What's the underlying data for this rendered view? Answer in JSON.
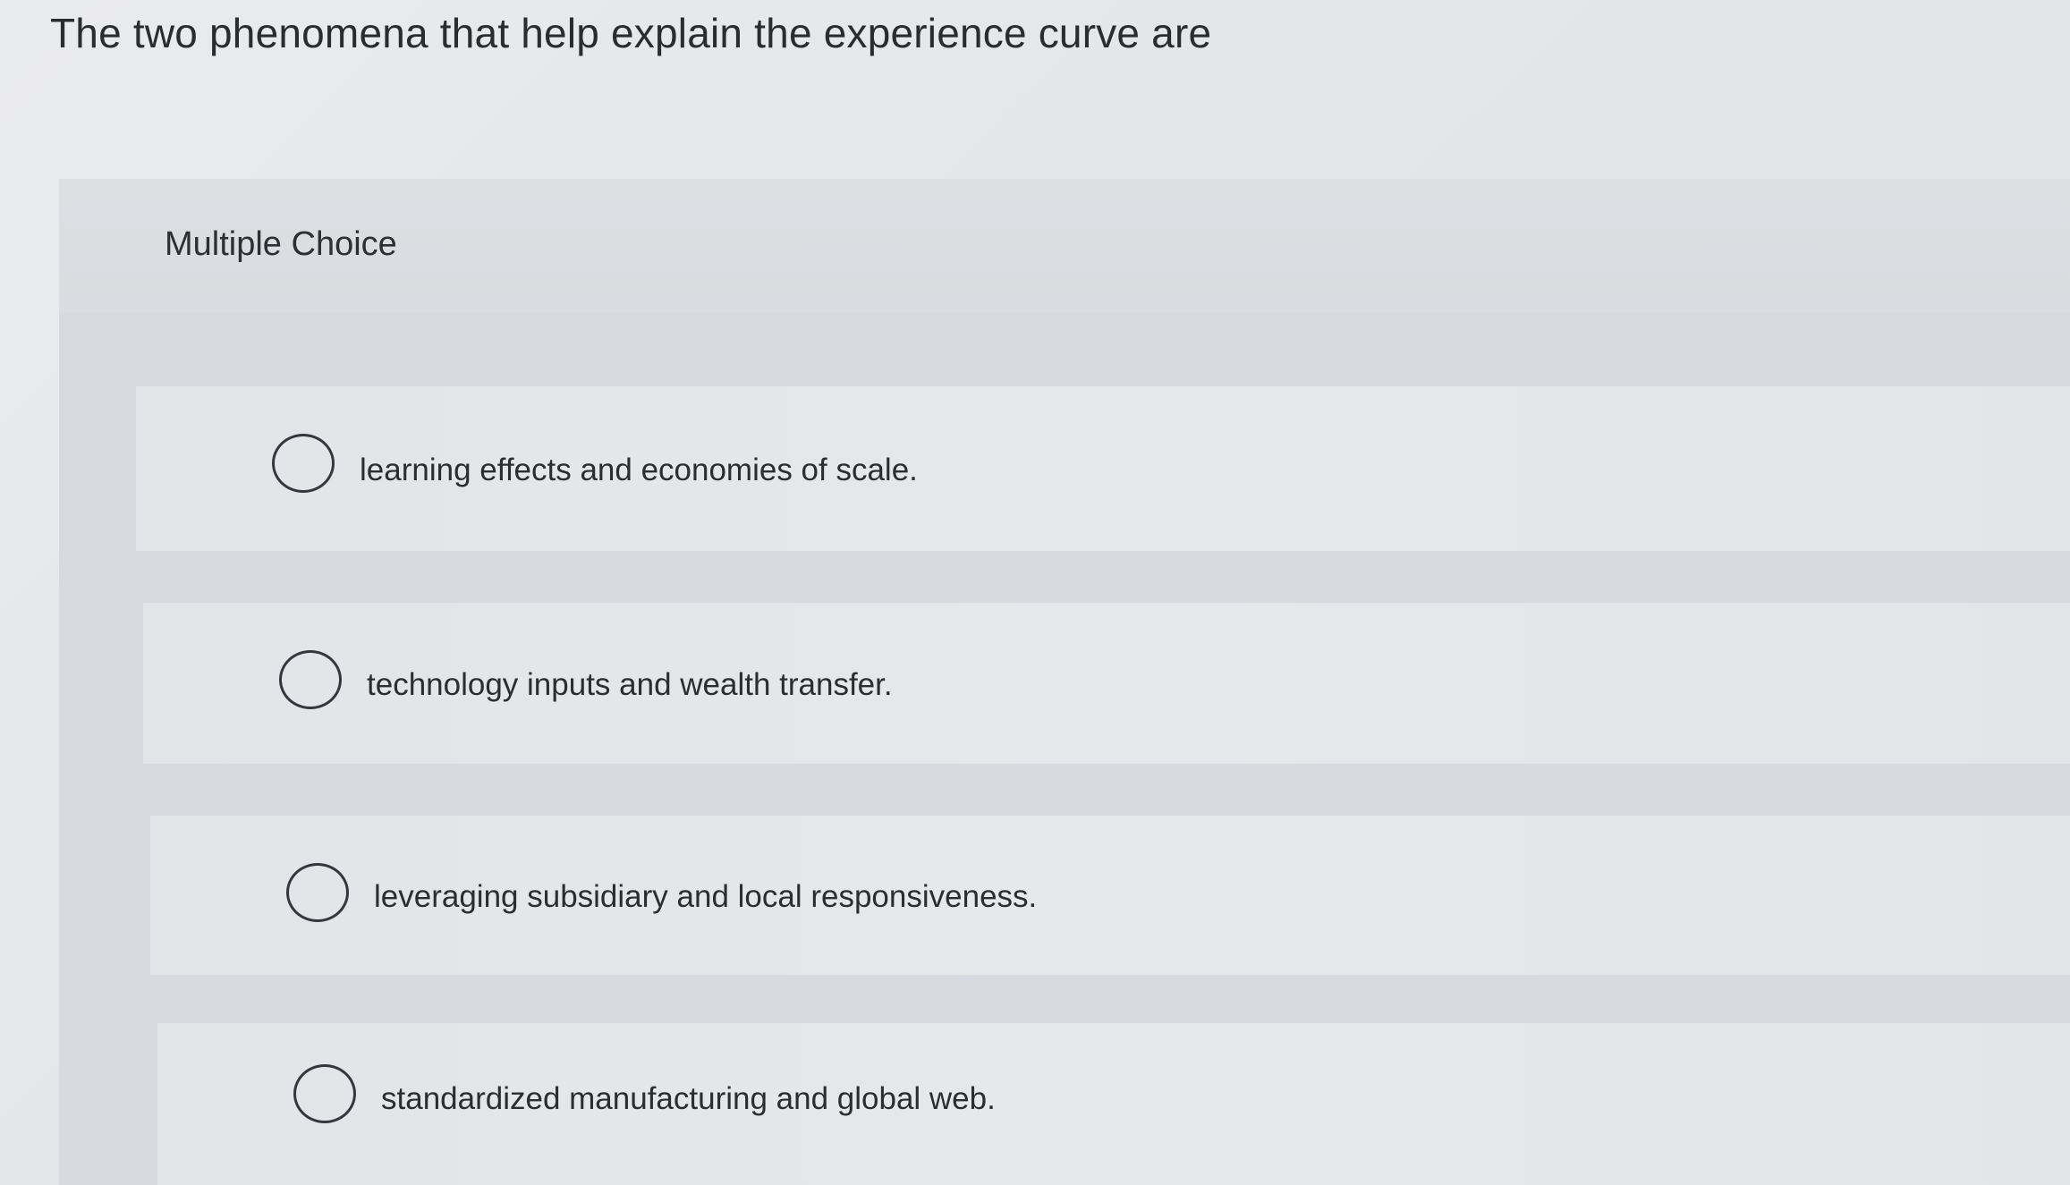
{
  "question": {
    "text": "The two phenomena that help explain the experience curve are"
  },
  "quiz": {
    "type_label": "Multiple Choice",
    "choices": [
      {
        "label": "learning effects and economies of scale.",
        "selected": false
      },
      {
        "label": "technology inputs and wealth transfer.",
        "selected": false
      },
      {
        "label": "leveraging subsidiary and local responsiveness.",
        "selected": false
      },
      {
        "label": "standardized manufacturing and global web.",
        "selected": false
      }
    ]
  },
  "colors": {
    "background": "#e6e8eb",
    "panel": "#d7dade",
    "choice_row": "#e4e6e9",
    "text": "#2b2d31",
    "radio_border": "#34373c"
  }
}
